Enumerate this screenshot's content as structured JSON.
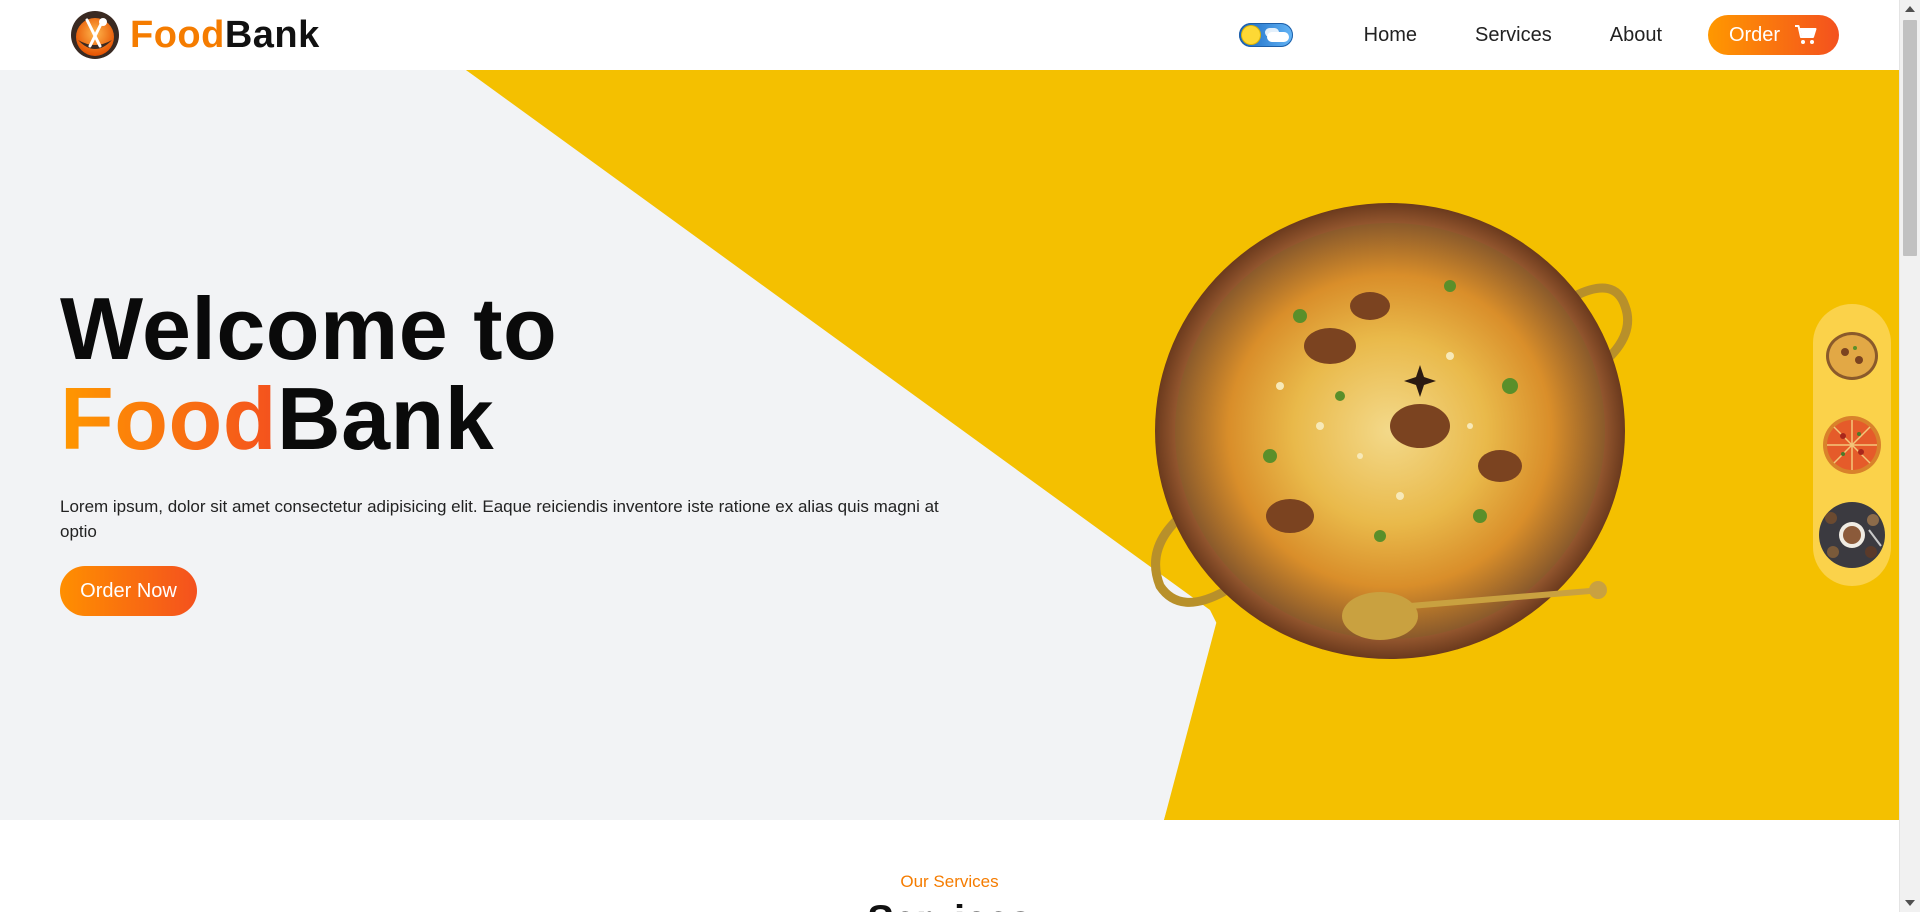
{
  "nav": {
    "brand_food": "Food",
    "brand_bank": "Bank",
    "links": [
      "Home",
      "Services",
      "About"
    ],
    "order_label": "Order",
    "theme_toggle_state": "light"
  },
  "hero": {
    "title_line1": "Welcome to",
    "title_food": "Food",
    "title_bank": "Bank",
    "description": "Lorem ipsum, dolor sit amet consectetur adipisicing elit. Eaque reiciendis inventore iste ratione ex alias quis magni at optio",
    "cta_label": "Order Now"
  },
  "dish_thumbnails": [
    "biryani-pot",
    "pizza",
    "coffee-table"
  ],
  "services": {
    "subtitle": "Our Services",
    "title": "Services"
  },
  "colors": {
    "accent_orange": "#f57c00",
    "hero_yellow": "#f4c000",
    "hero_gray": "#f2f3f5"
  }
}
